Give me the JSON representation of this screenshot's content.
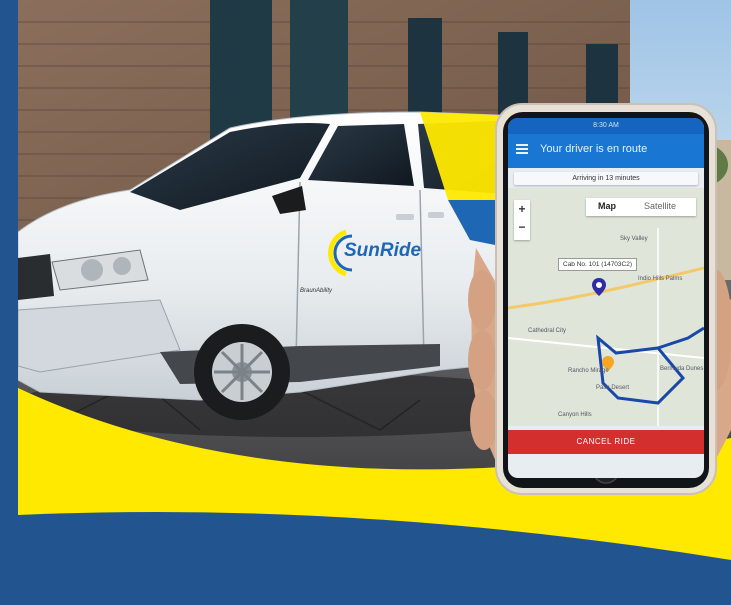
{
  "brand": {
    "logo_text": "SunRide",
    "van_badge": "BraunAbility"
  },
  "phone": {
    "status_time": "8:30 AM",
    "header_title": "Your driver is en route",
    "arrival_text": "Arriving in 13 minutes",
    "map_tab": "Map",
    "satellite_tab": "Satellite",
    "zoom_in": "+",
    "zoom_out": "−",
    "cab_label": "Cab No. 101 (14703C2)",
    "places": {
      "sky_valley": "Sky Valley",
      "cathedral_city": "Cathedral City",
      "rancho_mirage": "Rancho Mirage",
      "palm_desert": "Palm Desert",
      "bermuda_dunes": "Bermuda Dunes",
      "indio_hills": "Indio Hills Palms",
      "canyon_hills": "Canyon Hills"
    },
    "cancel_button": "CANCEL RIDE"
  },
  "colors": {
    "blue_bg": "#22558f",
    "yellow": "#ffe900",
    "app_blue": "#1976d2",
    "cancel_red": "#d32f2f"
  }
}
